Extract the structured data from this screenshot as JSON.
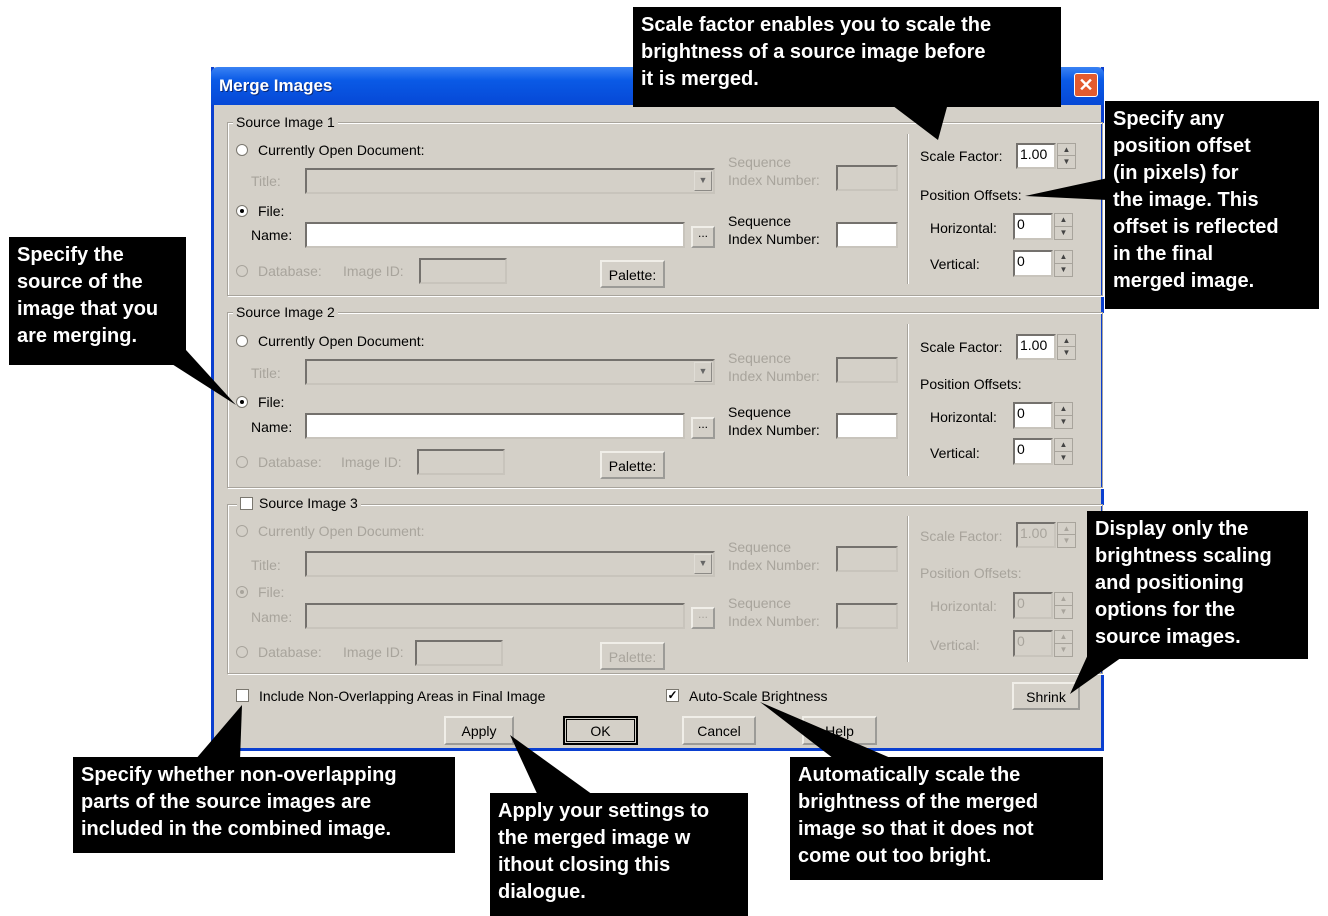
{
  "dialog": {
    "title": "Merge Images",
    "close_glyph": "✕",
    "source1": {
      "legend": "Source Image 1",
      "current_doc": "Currently Open Document:",
      "title_label": "Title:",
      "file_label": "File:",
      "name_label": "Name:",
      "database_label": "Database:",
      "image_id_label": "Image ID:",
      "seq1_line1": "Sequence",
      "seq1_line2": "Index Number:",
      "seq2_line1": "Sequence",
      "seq2_line2": "Index Number:",
      "palette": "Palette:",
      "browse": "...",
      "scale_label": "Scale Factor:",
      "scale_value": "1.00",
      "offsets_label": "Position Offsets:",
      "horizontal_label": "Horizontal:",
      "horizontal_value": "0",
      "vertical_label": "Vertical:",
      "vertical_value": "0"
    },
    "source2": {
      "legend": "Source Image 2",
      "current_doc": "Currently Open Document:",
      "title_label": "Title:",
      "file_label": "File:",
      "name_label": "Name:",
      "database_label": "Database:",
      "image_id_label": "Image ID:",
      "seq1_line1": "Sequence",
      "seq1_line2": "Index Number:",
      "seq2_line1": "Sequence",
      "seq2_line2": "Index Number:",
      "palette": "Palette:",
      "browse": "...",
      "scale_label": "Scale Factor:",
      "scale_value": "1.00",
      "offsets_label": "Position Offsets:",
      "horizontal_label": "Horizontal:",
      "horizontal_value": "0",
      "vertical_label": "Vertical:",
      "vertical_value": "0"
    },
    "source3": {
      "legend": "Source Image 3",
      "current_doc": "Currently Open Document:",
      "title_label": "Title:",
      "file_label": "File:",
      "name_label": "Name:",
      "database_label": "Database:",
      "image_id_label": "Image ID:",
      "seq1_line1": "Sequence",
      "seq1_line2": "Index Number:",
      "seq2_line1": "Sequence",
      "seq2_line2": "Index Number:",
      "palette": "Palette:",
      "browse": "...",
      "scale_label": "Scale Factor:",
      "scale_value": "1.00",
      "offsets_label": "Position Offsets:",
      "horizontal_label": "Horizontal:",
      "horizontal_value": "0",
      "vertical_label": "Vertical:",
      "vertical_value": "0"
    },
    "include_non_overlapping": "Include Non-Overlapping Areas in Final Image",
    "auto_scale": "Auto-Scale Brightness",
    "auto_scale_check": "✓",
    "buttons": {
      "shrink": "Shrink",
      "apply": "Apply",
      "ok": "OK",
      "cancel": "Cancel",
      "help": "Help"
    }
  },
  "callouts": {
    "scale_factor": "Scale factor enables you  to scale the\nbrightness of a source image before\nit is merged.",
    "position_offset": "Specify any\nposition offset\n(in pixels) for\nthe image. This\noffset is reflected\nin the final\nmerged image.",
    "source": "Specify the\nsource of the\nimage that you\nare merging.",
    "shrink": "Display only the\nbrightness scaling\nand positioning\noptions for the\nsource images.",
    "non_overlapping": "Specify whether non-overlapping\nparts of the source images are\nincluded in the combined image.",
    "apply": "Apply your settings to\nthe merged image w\nithout closing this\ndialogue.",
    "auto_scale": "Automatically scale the\nbrightness of the merged\nimage so that it does not\ncome out too bright."
  }
}
